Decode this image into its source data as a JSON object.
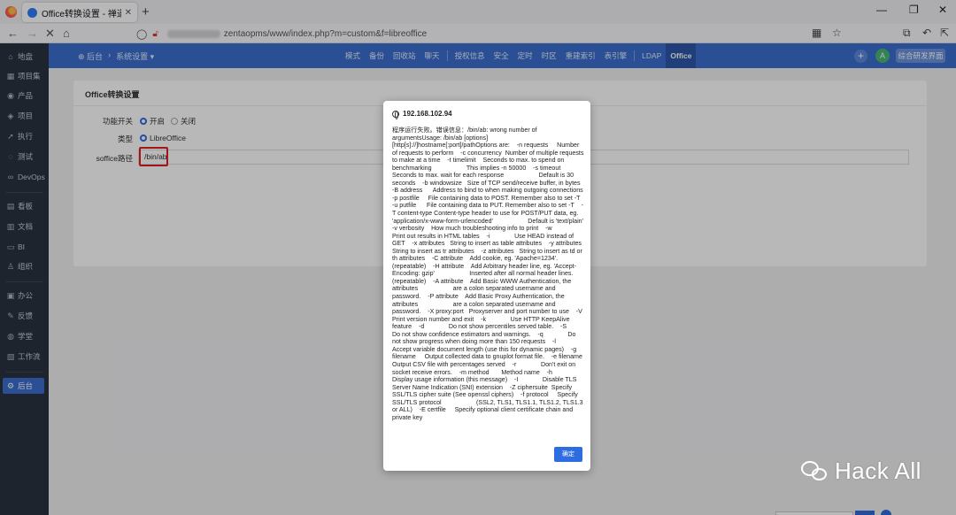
{
  "browser": {
    "tab_title": "Office转换设置 - 禅道",
    "tab_close": "✕",
    "new_tab": "+",
    "url_path": "zentaopms/www/index.php?m=custom&f=libreoffice",
    "back": "←",
    "forward": "→",
    "stop": "✕",
    "home": "⌂",
    "window_controls": [
      "—",
      "❐",
      "✕"
    ]
  },
  "header": {
    "breadcrumb_home": "后台",
    "breadcrumb_section": "系统设置",
    "menu": [
      "模式",
      "备份",
      "回收站",
      "聊天",
      "|",
      "授权信息",
      "安全",
      "定时",
      "时区",
      "重建索引",
      "表引擎",
      "|",
      "LDAP",
      "Office"
    ],
    "avatar": "A",
    "button": "综合研发界面"
  },
  "sidebar": {
    "items": [
      {
        "icon": "⌂",
        "label": "地盘"
      },
      {
        "icon": "▦",
        "label": "项目集"
      },
      {
        "icon": "◉",
        "label": "产品"
      },
      {
        "icon": "◈",
        "label": "项目"
      },
      {
        "icon": "➚",
        "label": "执行"
      },
      {
        "icon": "◌",
        "label": "测试"
      },
      {
        "icon": "∞",
        "label": "DevOps"
      },
      {
        "icon": "▤",
        "label": "看板"
      },
      {
        "icon": "▥",
        "label": "文档"
      },
      {
        "icon": "▭",
        "label": "BI"
      },
      {
        "icon": "♙",
        "label": "组织"
      },
      {
        "icon": "▣",
        "label": "办公"
      },
      {
        "icon": "✎",
        "label": "反馈"
      },
      {
        "icon": "◍",
        "label": "学堂"
      },
      {
        "icon": "▧",
        "label": "工作流"
      },
      {
        "icon": "⚙",
        "label": "后台"
      }
    ],
    "active_index": 15
  },
  "form": {
    "title": "Office转换设置",
    "switch_label": "功能开关",
    "switch_on": "开启",
    "switch_off": "关闭",
    "switch_value": "on",
    "type_label": "类型",
    "type_value": "LibreOffice",
    "path_label": "soffice路径",
    "path_value": "/bin/ab"
  },
  "dialog": {
    "origin": "192.168.102.94",
    "message": "程序运行失败。错误信息：/bin/ab: wrong number of argumentsUsage: /bin/ab [options] [http[s]://]hostname[:port]/pathOptions are:    -n requests     Number of requests to perform    -c concurrency  Number of multiple requests to make at a time    -t timelimit    Seconds to max. to spend on benchmarking                    This implies -n 50000    -s timeout      Seconds to max. wait for each response                    Default is 30 seconds    -b windowsize   Size of TCP send/receive buffer, in bytes    -B address      Address to bind to when making outgoing connections    -p postfile     File containing data to POST. Remember also to set -T    -u putfile      File containing data to PUT. Remember also to set -T    -T content-type Content-type header to use for POST/PUT data, eg.                    'application/x-www-form-urlencoded'                    Default is 'text/plain'    -v verbosity    How much troubleshooting info to print    -w              Print out results in HTML tables    -i              Use HEAD instead of GET    -x attributes   String to insert as table attributes    -y attributes   String to insert as tr attributes    -z attributes   String to insert as td or th attributes    -C attribute    Add cookie, eg. 'Apache=1234'. (repeatable)    -H attribute    Add Arbitrary header line, eg. 'Accept-Encoding: gzip'                    Inserted after all normal header lines. (repeatable)    -A attribute    Add Basic WWW Authentication, the attributes                    are a colon separated username and password.    -P attribute    Add Basic Proxy Authentication, the attributes                    are a colon separated username and password.    -X proxy:port   Proxyserver and port number to use    -V              Print version number and exit    -k              Use HTTP KeepAlive feature    -d              Do not show percentiles served table.    -S              Do not show confidence estimators and warnings.    -q              Do not show progress when doing more than 150 requests    -l              Accept variable document length (use this for dynamic pages)    -g filename     Output collected data to gnuplot format file.    -e filename     Output CSV file with percentages served    -r              Don't exit on socket receive errors.    -m method       Method name    -h              Display usage information (this message)    -I              Disable TLS Server Name Indication (SNI) extension    -Z ciphersuite  Specify SSL/TLS cipher suite (See openssl ciphers)    -f protocol     Specify SSL/TLS protocol                    (SSL2, TLS1, TLS1.1, TLS1.2, TLS1.3 or ALL)    -E certfile     Specify optional client certificate chain and private key",
    "ok_button": "确定"
  },
  "watermark": {
    "text": "Hack All"
  }
}
